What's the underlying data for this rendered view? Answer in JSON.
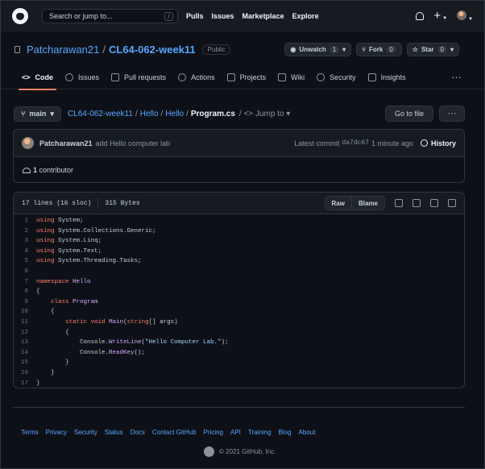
{
  "topbar": {
    "search_placeholder": "Search or jump to...",
    "search_shortcut": "/",
    "nav": [
      "Pulls",
      "Issues",
      "Marketplace",
      "Explore"
    ],
    "plus": "+"
  },
  "repo": {
    "owner": "Patcharawan21",
    "separator": "/",
    "name": "CL64-062-week11",
    "visibility": "Public",
    "unwatch_label": "Unwatch",
    "unwatch_count": "1",
    "fork_label": "Fork",
    "fork_count": "0",
    "star_label": "Star",
    "star_count": "0"
  },
  "tabs": [
    {
      "label": "Code",
      "icon": "code-icon"
    },
    {
      "label": "Issues",
      "icon": "issue-icon"
    },
    {
      "label": "Pull requests",
      "icon": "pull-request-icon"
    },
    {
      "label": "Actions",
      "icon": "play-icon"
    },
    {
      "label": "Projects",
      "icon": "project-icon"
    },
    {
      "label": "Wiki",
      "icon": "book-icon"
    },
    {
      "label": "Security",
      "icon": "shield-icon"
    },
    {
      "label": "Insights",
      "icon": "graph-icon"
    }
  ],
  "file_nav": {
    "branch": "main",
    "path": [
      "CL64-062-week11",
      "Hello",
      "Hello"
    ],
    "file": "Program.cs",
    "jump_to": "Jump to",
    "go_to_file": "Go to file",
    "more": "···"
  },
  "commit": {
    "author": "Patcharawan21",
    "message": "add Hello computer lab",
    "latest_label": "Latest commit",
    "sha": "da7dc67",
    "time": "1 minute ago",
    "history_label": "History",
    "contributors_count": "1",
    "contributors_label": "contributor"
  },
  "file": {
    "lines_info": "17 lines (16 sloc)",
    "size": "315 Bytes",
    "raw_label": "Raw",
    "blame_label": "Blame",
    "code": [
      [
        [
          "kw",
          "using"
        ],
        [
          "nm",
          " System;"
        ]
      ],
      [
        [
          "kw",
          "using"
        ],
        [
          "nm",
          " System.Collections.Generic;"
        ]
      ],
      [
        [
          "kw",
          "using"
        ],
        [
          "nm",
          " System.Linq;"
        ]
      ],
      [
        [
          "kw",
          "using"
        ],
        [
          "nm",
          " System.Text;"
        ]
      ],
      [
        [
          "kw",
          "using"
        ],
        [
          "nm",
          " System.Threading.Tasks;"
        ]
      ],
      [
        [
          "nm",
          ""
        ]
      ],
      [
        [
          "kw",
          "namespace"
        ],
        [
          "tn",
          " Hello"
        ]
      ],
      [
        [
          "nm",
          "{"
        ]
      ],
      [
        [
          "nm",
          "    "
        ],
        [
          "kw",
          "class"
        ],
        [
          "tn",
          " Program"
        ]
      ],
      [
        [
          "nm",
          "    {"
        ]
      ],
      [
        [
          "nm",
          "        "
        ],
        [
          "kw",
          "static"
        ],
        [
          "nm",
          " "
        ],
        [
          "kw",
          "void"
        ],
        [
          "tn",
          " Main"
        ],
        [
          "nm",
          "("
        ],
        [
          "kw",
          "string"
        ],
        [
          "nm",
          "[] args)"
        ]
      ],
      [
        [
          "nm",
          "        {"
        ]
      ],
      [
        [
          "nm",
          "            Console."
        ],
        [
          "tn",
          "WriteLine"
        ],
        [
          "nm",
          "("
        ],
        [
          "str",
          "\"Hello Computer Lab.\""
        ],
        [
          "nm",
          ");"
        ]
      ],
      [
        [
          "nm",
          "            Console."
        ],
        [
          "tn",
          "ReadKey"
        ],
        [
          "nm",
          "();"
        ]
      ],
      [
        [
          "nm",
          "        }"
        ]
      ],
      [
        [
          "nm",
          "    }"
        ]
      ],
      [
        [
          "nm",
          "}"
        ]
      ]
    ]
  },
  "footer": {
    "links": [
      "Terms",
      "Privacy",
      "Security",
      "Status",
      "Docs",
      "Contact GitHub",
      "Pricing",
      "API",
      "Training",
      "Blog",
      "About"
    ],
    "copyright": "© 2021 GitHub, Inc."
  }
}
